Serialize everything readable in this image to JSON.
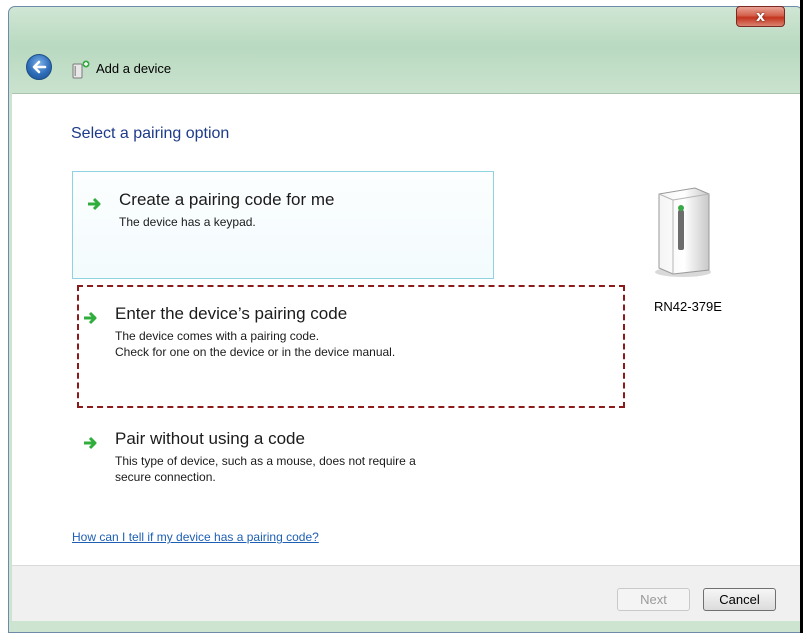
{
  "window": {
    "title": "Add a device",
    "close_symbol": "x"
  },
  "heading": "Select a pairing option",
  "options": [
    {
      "title": "Create a pairing code for me",
      "desc_lines": [
        "The device has a keypad."
      ]
    },
    {
      "title": "Enter the device’s pairing code",
      "desc_lines": [
        "The device comes with a pairing code.",
        "Check for one on the device or in the device manual."
      ]
    },
    {
      "title": "Pair without using a code",
      "desc_lines": [
        "This type of device, such as a mouse, does not require a",
        "secure connection."
      ]
    }
  ],
  "device": {
    "name": "RN42-379E",
    "icon": "device-tower-icon"
  },
  "help_link": "How can I tell if my device has a pairing code?",
  "buttons": {
    "next": "Next",
    "cancel": "Cancel"
  },
  "colors": {
    "accent_arrow": "#2fae3b",
    "heading": "#1e3a8a",
    "link": "#1e5fb4",
    "highlight_frame": "#8b1a1a"
  }
}
